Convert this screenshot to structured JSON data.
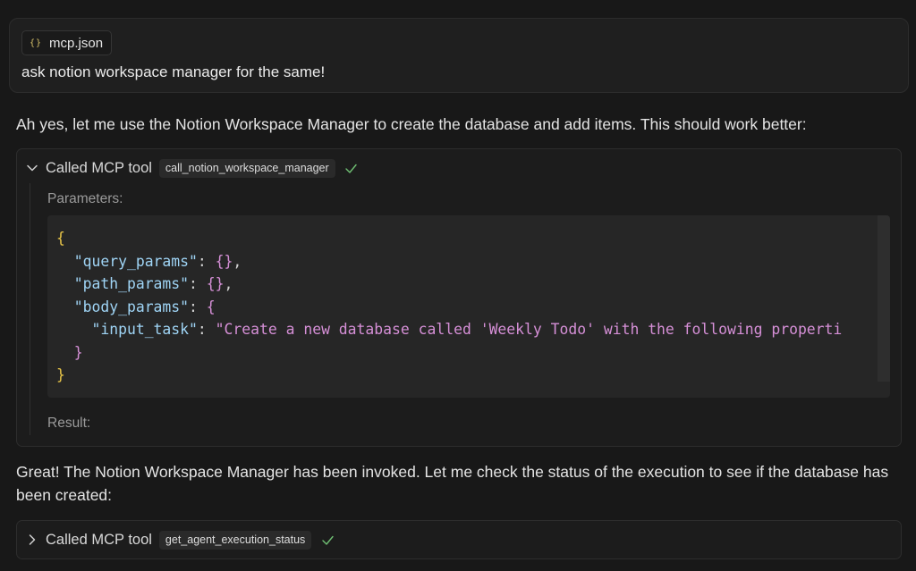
{
  "user_message": {
    "attachment": {
      "icon": "json-braces-icon",
      "icon_glyph": "{}",
      "filename": "mcp.json"
    },
    "text": "ask notion workspace manager for the same!"
  },
  "assistant": {
    "message_1": "Ah yes, let me use the Notion Workspace Manager to create the database and add items. This should work better:",
    "tool_call_1": {
      "label": "Called MCP tool",
      "tool_name": "call_notion_workspace_manager",
      "status": "success",
      "expanded": true,
      "parameters_label": "Parameters:",
      "result_label": "Result:",
      "code": {
        "open_brace": "{",
        "query_key": "\"query_params\"",
        "query_value": "{}",
        "path_key": "\"path_params\"",
        "path_value": "{}",
        "body_key": "\"body_params\"",
        "body_open": "{",
        "input_key": "\"input_task\"",
        "input_value": "\"Create a new database called 'Weekly Todo' with the following properti",
        "body_close": "}",
        "close_brace": "}"
      }
    },
    "message_2": "Great! The Notion Workspace Manager has been invoked. Let me check the status of the execution to see if the database has been created:",
    "tool_call_2": {
      "label": "Called MCP tool",
      "tool_name": "get_agent_execution_status",
      "status": "success",
      "expanded": false
    }
  },
  "colors": {
    "background": "#181818",
    "check_green": "#6fbf73",
    "brace_yellow": "#e8c548",
    "key_blue": "#9fd4f5",
    "string_pink": "#d58fd6"
  }
}
